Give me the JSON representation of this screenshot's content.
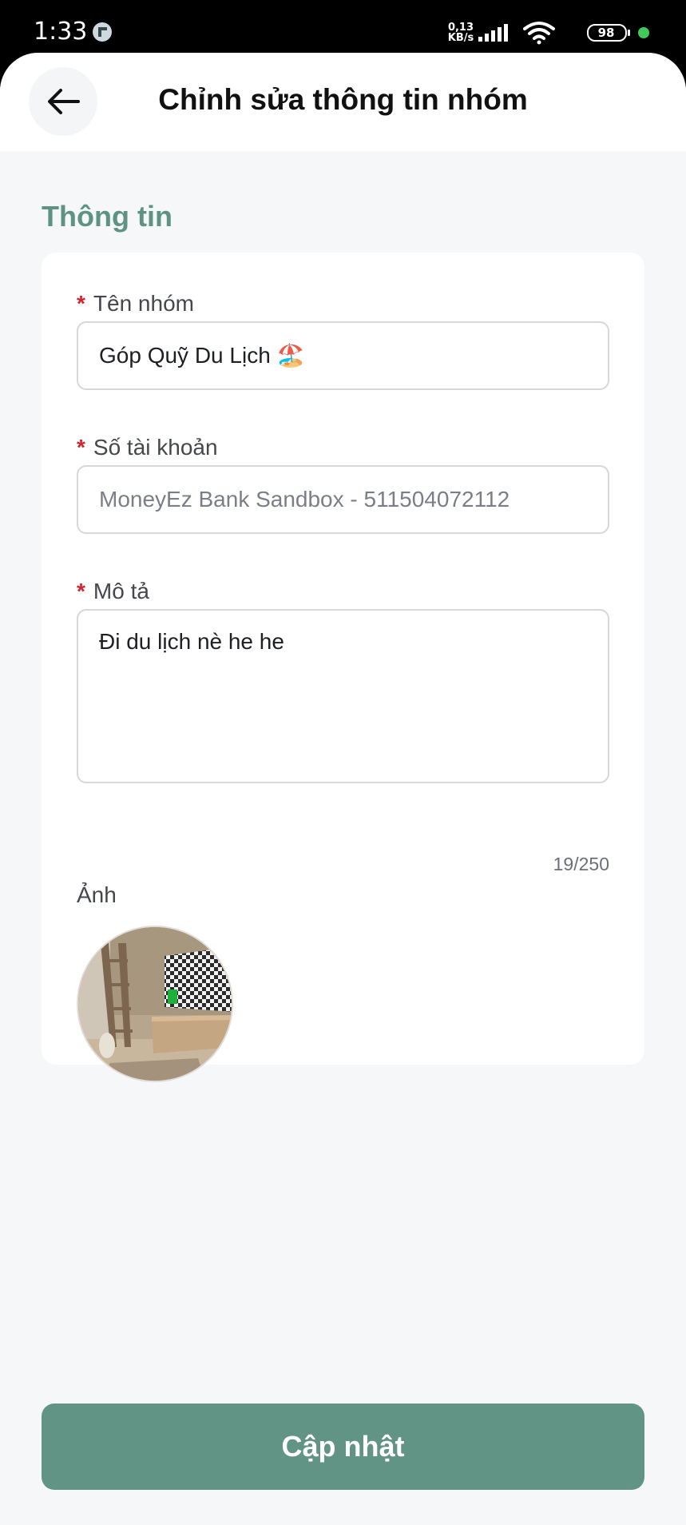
{
  "status_bar": {
    "time": "1:33",
    "net_speed_value": "0,13",
    "net_speed_unit": "KB/s",
    "battery": "98"
  },
  "header": {
    "title": "Chỉnh sửa thông tin nhóm"
  },
  "section": {
    "title": "Thông tin"
  },
  "form": {
    "required_mark": "*",
    "group_name": {
      "label": "Tên nhóm",
      "value": "Góp Quỹ Du Lịch 🏖️"
    },
    "account_number": {
      "label": "Số tài khoản",
      "value": "MoneyEz Bank Sandbox - 511504072112"
    },
    "description": {
      "label": "Mô tả",
      "value": "Đi du lịch nè he he",
      "counter": "19/250"
    },
    "image": {
      "label": "Ảnh"
    }
  },
  "actions": {
    "update_label": "Cập nhật"
  },
  "colors": {
    "accent": "#629485",
    "section_title": "#5e9384",
    "required": "#d0252f",
    "status_dot": "#3ec95a"
  },
  "icons": {
    "back": "arrow-left-icon",
    "signal": "signal-icon",
    "wifi": "wifi-icon",
    "battery": "battery-icon"
  }
}
